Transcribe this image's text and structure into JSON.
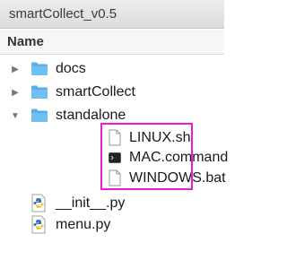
{
  "window": {
    "title": "smartCollect_v0.5"
  },
  "column_header": {
    "name_label": "Name"
  },
  "highlight_color": "#e81ed0",
  "items": [
    {
      "label": "docs",
      "icon": "folder-icon",
      "disclosure": "collapsed"
    },
    {
      "label": "smartCollect",
      "icon": "folder-icon",
      "disclosure": "collapsed"
    },
    {
      "label": "standalone",
      "icon": "folder-icon",
      "disclosure": "expanded"
    },
    {
      "label": "LINUX.sh",
      "icon": "document-icon"
    },
    {
      "label": "MAC.command",
      "icon": "terminal-icon"
    },
    {
      "label": "WINDOWS.bat",
      "icon": "document-icon"
    },
    {
      "label": "__init__.py",
      "icon": "python-file-icon"
    },
    {
      "label": "menu.py",
      "icon": "python-file-icon"
    }
  ]
}
